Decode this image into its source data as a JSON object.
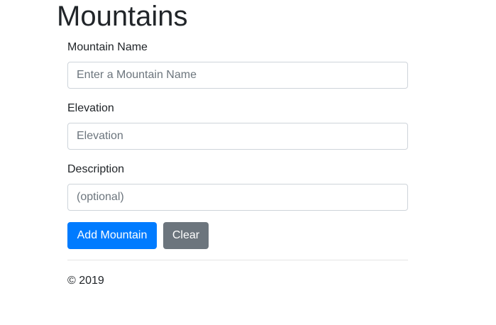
{
  "title": "Mountains",
  "form": {
    "name": {
      "label": "Mountain Name",
      "placeholder": "Enter a Mountain Name"
    },
    "elevation": {
      "label": "Elevation",
      "placeholder": "Elevation"
    },
    "description": {
      "label": "Description",
      "placeholder": "(optional)"
    },
    "add_label": "Add Mountain",
    "clear_label": "Clear"
  },
  "colors": {
    "primary": "#007bff",
    "secondary": "#6c757d"
  },
  "footer": "© 2019"
}
